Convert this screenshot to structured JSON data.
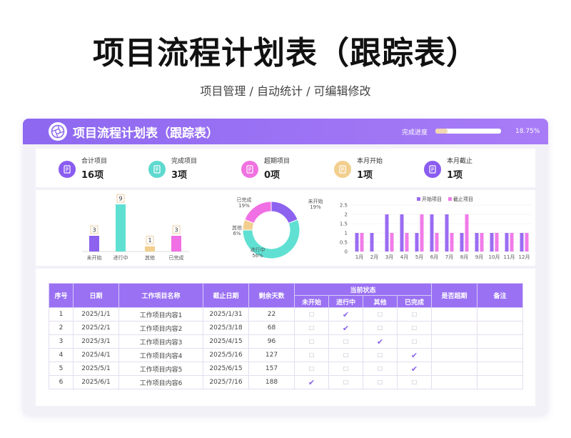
{
  "title": "项目流程计划表（跟踪表）",
  "subtitle": "项目管理 / 自动统计 / 可编辑修改",
  "header": {
    "title": "项目流程计划表（跟踪表）",
    "progress_label": "完成进度",
    "progress_value": "18.75%",
    "progress_fraction": 0.1875
  },
  "stats": [
    {
      "label": "合计项目",
      "value": "16项",
      "color": "#8a5cf0"
    },
    {
      "label": "完成项目",
      "value": "3项",
      "color": "#5ed9cf"
    },
    {
      "label": "超期项目",
      "value": "0项",
      "color": "#f071e0"
    },
    {
      "label": "本月开始",
      "value": "1项",
      "color": "#f2cf8e"
    },
    {
      "label": "本月截止",
      "value": "1项",
      "color": "#8a5cf0"
    }
  ],
  "chart_data": [
    {
      "type": "bar",
      "categories": [
        "未开始",
        "进行中",
        "其他",
        "已完成"
      ],
      "values": [
        3,
        9,
        1,
        3
      ],
      "colors": [
        "#8c62ef",
        "#5fe0d2",
        "#f2cf8e",
        "#f06fe4"
      ],
      "ylim": [
        0,
        9
      ]
    },
    {
      "type": "pie",
      "labels": [
        "未开始",
        "进行中",
        "其他",
        "已完成"
      ],
      "values": [
        19,
        56,
        6,
        19
      ],
      "percent_labels": [
        "19%",
        "56%",
        "6%",
        "19%"
      ],
      "colors": [
        "#8c62ef",
        "#5fe0d2",
        "#f2cf8e",
        "#f06fe4"
      ]
    },
    {
      "type": "bar",
      "categories": [
        "1月",
        "2月",
        "3月",
        "4月",
        "5月",
        "6月",
        "7月",
        "8月",
        "9月",
        "10月",
        "11月",
        "12月"
      ],
      "series": [
        {
          "name": "开始项目",
          "values": [
            1,
            1,
            2,
            2,
            1,
            2,
            2,
            1,
            1,
            1,
            1,
            1
          ],
          "color": "#9a6cf2"
        },
        {
          "name": "截止项目",
          "values": [
            1,
            0,
            1,
            1,
            2,
            1,
            1,
            2,
            1,
            1,
            1,
            1
          ],
          "color": "#f07be8"
        }
      ],
      "yticks": [
        "0",
        "0.5",
        "1",
        "1.5",
        "2",
        "2.5"
      ],
      "ylim": [
        0,
        2.5
      ],
      "legend": "top"
    }
  ],
  "table": {
    "headers": {
      "seq": "序号",
      "date": "日期",
      "name": "工作项目名称",
      "deadline": "截止日期",
      "remaining": "剩余天数",
      "status": "当前状态",
      "overdue": "是否超期",
      "note": "备注"
    },
    "status_cols": [
      "未开始",
      "进行中",
      "其他",
      "已完成"
    ],
    "rows": [
      {
        "seq": "1",
        "date": "2025/1/1",
        "name": "工作项目内容1",
        "deadline": "2025/1/31",
        "remaining": "22",
        "status": 1
      },
      {
        "seq": "2",
        "date": "2025/2/1",
        "name": "工作项目内容2",
        "deadline": "2025/3/18",
        "remaining": "68",
        "status": 1
      },
      {
        "seq": "3",
        "date": "2025/3/1",
        "name": "工作项目内容3",
        "deadline": "2025/4/15",
        "remaining": "96",
        "status": 2
      },
      {
        "seq": "4",
        "date": "2025/4/1",
        "name": "工作项目内容4",
        "deadline": "2025/5/16",
        "remaining": "127",
        "status": 3
      },
      {
        "seq": "5",
        "date": "2025/5/1",
        "name": "工作项目内容5",
        "deadline": "2025/6/15",
        "remaining": "157",
        "status": 3
      },
      {
        "seq": "6",
        "date": "2025/6/1",
        "name": "工作项目内容6",
        "deadline": "2025/7/16",
        "remaining": "188",
        "status": 0
      }
    ],
    "check_on": "✔",
    "check_off": "□"
  }
}
